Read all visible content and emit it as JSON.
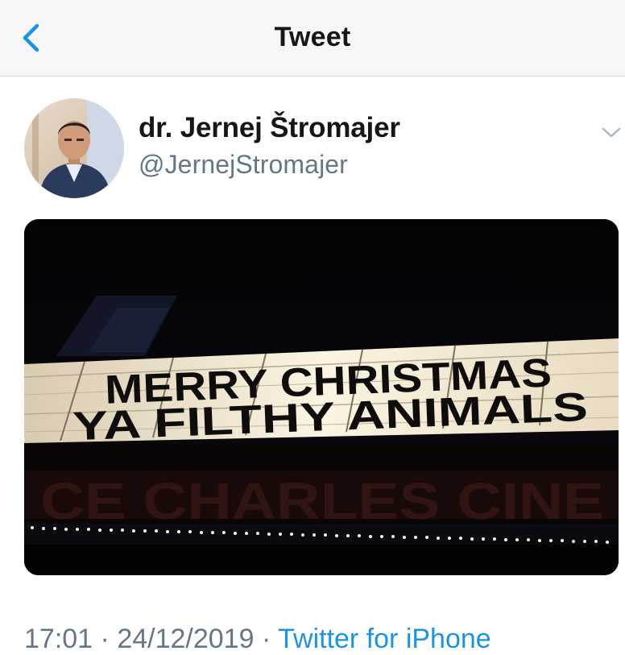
{
  "header": {
    "title": "Tweet",
    "back_icon": "chevron-left-icon",
    "accent": "#1b95e0"
  },
  "tweet": {
    "display_name": "dr. Jernej Štromajer",
    "handle": "@JernejStromajer",
    "more_icon": "chevron-down-icon",
    "media": {
      "marquee_line1": "MERRY CHRISTMAS",
      "marquee_line2": "YA FILTHY ANIMALS",
      "facade_sign": "CE CHARLES CINE"
    },
    "time": "17:01",
    "separator": "·",
    "date": "24/12/2019",
    "source": "Twitter for iPhone"
  },
  "colors": {
    "text_primary": "#14171a",
    "text_secondary": "#657786",
    "link": "#1b95e0",
    "header_bg": "#f7f7f8",
    "divider": "#d6dadd"
  }
}
